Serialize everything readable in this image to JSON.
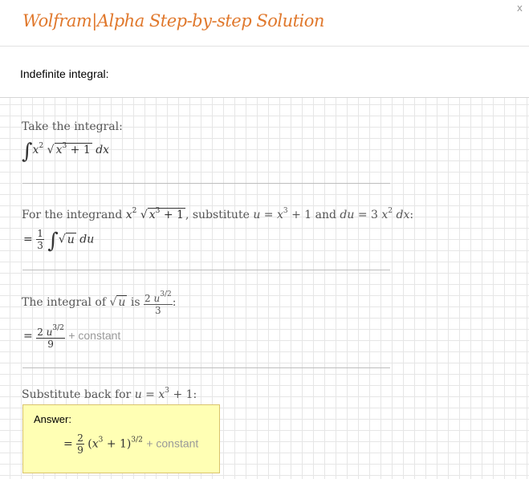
{
  "header": {
    "brand": "Wolfram|Alpha Step-by-step Solution",
    "close": "x"
  },
  "subtitle": "Indefinite integral:",
  "steps": {
    "s1": {
      "text": "Take the integral:"
    },
    "s2": {
      "pre": "For the integrand",
      "mid": ", substitute",
      "and": "and",
      "end": ":"
    },
    "s3": {
      "pre": "The integral of",
      "is": "is",
      "end": ":",
      "constant": "+ constant"
    },
    "s4": {
      "text": "Substitute back for"
    }
  },
  "answer": {
    "label": "Answer:",
    "constant": "+ constant"
  }
}
